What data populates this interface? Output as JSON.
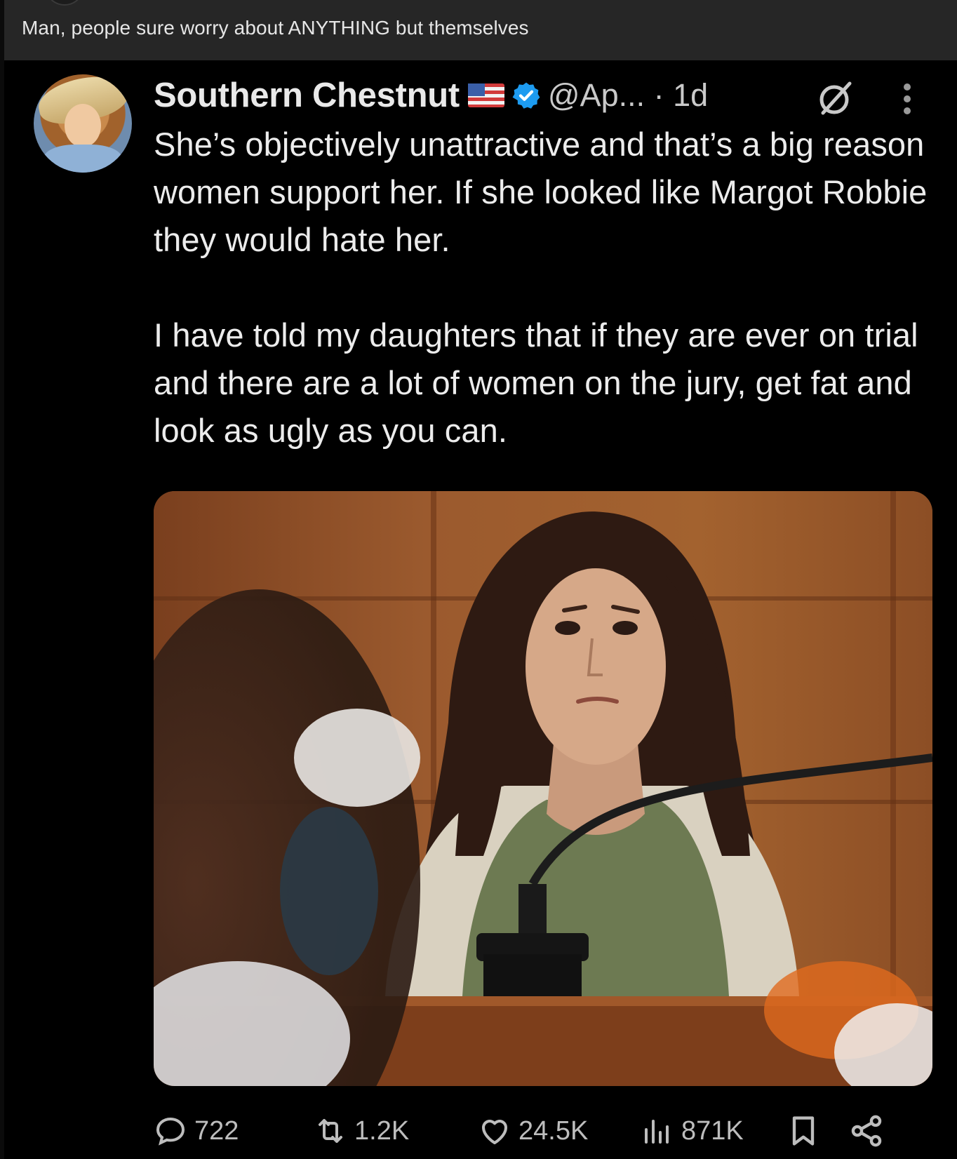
{
  "caption": "Man, people sure worry about ANYTHING but themselves",
  "tweet": {
    "display_name": "Southern Chestnut",
    "handle_time": "@Ap... · 1d",
    "paragraphs": [
      "She’s objectively unattractive and that’s a big reason women support her. If she looked like Margot Robbie they would hate her.",
      "I have told my daughters that if they are ever on trial and there are a lot of women on the jury, get fat and look as ugly as you can."
    ],
    "icons": {
      "flag": "us-flag-icon",
      "verified": "verified-badge-icon",
      "grok": "grok-icon",
      "more": "more-vertical-icon"
    },
    "actions": {
      "replies": "722",
      "reposts": "1.2K",
      "likes": "24.5K",
      "views": "871K"
    }
  },
  "colors": {
    "caption_bar": "#262626",
    "background": "#000000",
    "text": "#ececec",
    "secondary_text": "#bdbdbd",
    "verified_blue": "#1d9bf0"
  }
}
